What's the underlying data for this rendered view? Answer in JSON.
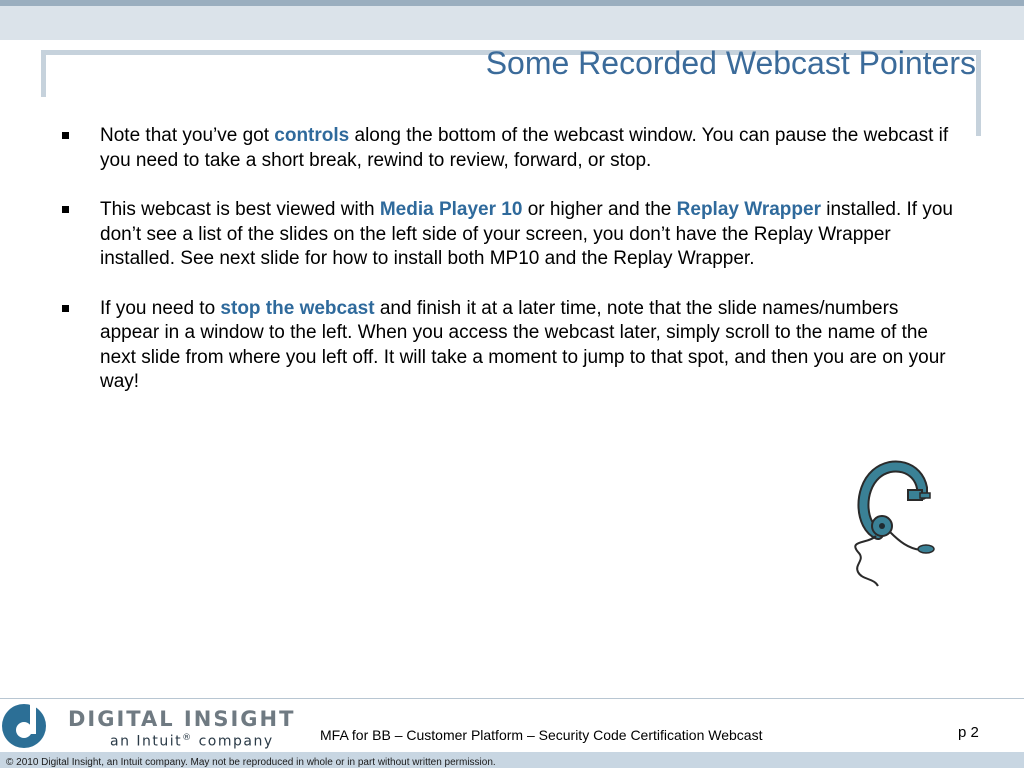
{
  "slide": {
    "title": "Some Recorded Webcast Pointers",
    "bullets": [
      {
        "parts": [
          {
            "text": "Note that you’ve got ",
            "highlight": false
          },
          {
            "text": "controls",
            "highlight": true
          },
          {
            "text": " along the bottom of the webcast window. You can pause the webcast if you need to take a short break, rewind to review, forward, or stop.",
            "highlight": false
          }
        ]
      },
      {
        "parts": [
          {
            "text": "This webcast is best viewed with ",
            "highlight": false
          },
          {
            "text": "Media Player 10",
            "highlight": true
          },
          {
            "text": " or higher and the ",
            "highlight": false
          },
          {
            "text": "Replay Wrapper",
            "highlight": true
          },
          {
            "text": " installed. If you don’t see a list of the slides on the left side of your screen, you don’t have the Replay Wrapper installed.  See next slide for how to install both MP10 and the Replay Wrapper.",
            "highlight": false
          }
        ]
      },
      {
        "parts": [
          {
            "text": "If you need to ",
            "highlight": false
          },
          {
            "text": "stop the webcast",
            "highlight": true
          },
          {
            "text": " and finish it at a later time, note that the slide names/numbers appear in a window to the left.  When you access the webcast later, simply scroll to the name of the next slide from where you left off.  It will take a moment to jump to that spot, and then you are on your way!",
            "highlight": false
          }
        ]
      }
    ]
  },
  "illustration": {
    "icon": "headset-icon"
  },
  "footer": {
    "logo": {
      "name": "DIGITAL INSIGHT",
      "tagline_pre": "an Intuit",
      "tagline_post": " company",
      "reg_mark": "®"
    },
    "center_text": "MFA for BB – Customer Platform – Security Code Certification Webcast",
    "page": "p 2",
    "copyright": "© 2010 Digital Insight, an Intuit company.  May not  be reproduced in whole or in part without written permission."
  },
  "colors": {
    "title": "#3b6b9a",
    "highlight": "#2f6a9c",
    "header_band": "#dbe3ea",
    "footer_band": "#c8d6e2",
    "logo_blue": "#2c6f96",
    "headset_teal": "#3a8196"
  }
}
